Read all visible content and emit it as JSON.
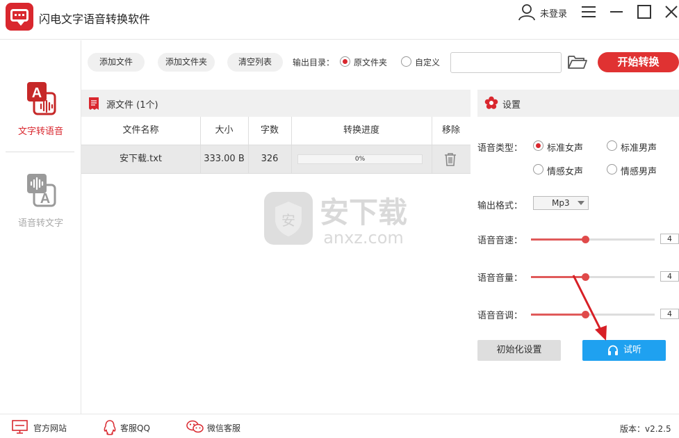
{
  "app": {
    "title": "闪电文字语音转换软件",
    "user_label": "未登录"
  },
  "sidebar": {
    "items": [
      {
        "label": "文字转语音"
      },
      {
        "label": "语音转文字"
      }
    ]
  },
  "toolbar": {
    "add_file": "添加文件",
    "add_folder": "添加文件夹",
    "clear_list": "清空列表",
    "output_dir_label": "输出目录：",
    "option_source": "原文件夹",
    "option_custom": "自定义",
    "path_value": "",
    "start_button": "开始转换"
  },
  "files": {
    "header": "源文件 (1个)",
    "columns": [
      "文件名称",
      "大小",
      "字数",
      "转换进度",
      "移除"
    ],
    "rows": [
      {
        "name": "安下载.txt",
        "size": "333.00 B",
        "words": "326",
        "progress": 0,
        "progress_text": "0%"
      }
    ]
  },
  "settings": {
    "title": "设置",
    "voice_type_label": "语音类型：",
    "voice_options": [
      "标准女声",
      "标准男声",
      "情感女声",
      "情感男声"
    ],
    "voice_selected": "标准女声",
    "format_label": "输出格式：",
    "format_value": "Mp3",
    "speed_label": "语音音速：",
    "speed_value": "4",
    "volume_label": "语音音量：",
    "volume_value": "4",
    "pitch_label": "语音音调：",
    "pitch_value": "4",
    "slider_level_fraction": 0.44,
    "reset_button": "初始化设置",
    "listen_button": "试听"
  },
  "statusbar": {
    "website": "官方网站",
    "qq": "客服QQ",
    "wechat": "微信客服",
    "version": "版本：v2.2.5"
  },
  "watermark": {
    "text": "安下载",
    "url": "anxz.com"
  },
  "colors": {
    "accent": "#d9272e",
    "start_button": "#e03232",
    "listen_button": "#1fa1f0"
  }
}
